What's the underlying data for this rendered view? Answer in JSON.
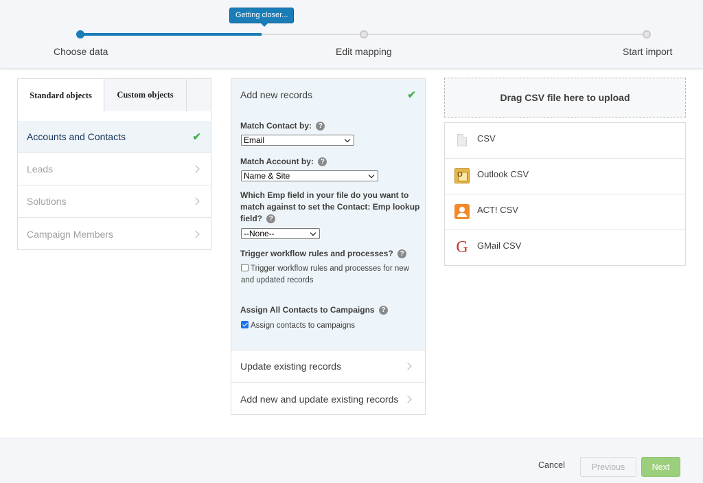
{
  "progress": {
    "tooltip": "Getting closer...",
    "fill_fraction": 0.32,
    "steps": [
      {
        "label": "Choose data",
        "state": "done"
      },
      {
        "label": "Edit mapping",
        "state": "todo"
      },
      {
        "label": "Start import",
        "state": "todo"
      }
    ]
  },
  "left_panel": {
    "tabs": [
      {
        "label": "Standard objects",
        "active": true
      },
      {
        "label": "Custom objects",
        "active": false
      }
    ],
    "items": [
      {
        "label": "Accounts and Contacts",
        "selected": true
      },
      {
        "label": "Leads",
        "selected": false
      },
      {
        "label": "Solutions",
        "selected": false
      },
      {
        "label": "Campaign Members",
        "selected": false
      }
    ]
  },
  "mid_panel": {
    "active_option": "Add new records",
    "match_contact": {
      "label": "Match Contact by:",
      "value": "Email"
    },
    "match_account": {
      "label": "Match Account by:",
      "value": "Name & Site"
    },
    "emp_field": {
      "label": "Which Emp field in your file do you want to match against to set the Contact: Emp lookup field?",
      "value": "--None--"
    },
    "trigger": {
      "label": "Trigger workflow rules and processes?",
      "checkbox_label": "Trigger workflow rules and processes for new and updated records",
      "checked": false
    },
    "campaigns": {
      "label": "Assign All Contacts to Campaigns",
      "checkbox_label": "Assign contacts to campaigns",
      "checked": true
    },
    "help_glyph": "?",
    "other_options": [
      {
        "label": "Update existing records"
      },
      {
        "label": "Add new and update existing records"
      }
    ]
  },
  "right_panel": {
    "drop_zone": "Drag CSV file here to upload",
    "sources": [
      {
        "label": "CSV",
        "icon": "document-icon"
      },
      {
        "label": "Outlook CSV",
        "icon": "outlook-icon"
      },
      {
        "label": "ACT! CSV",
        "icon": "act-icon"
      },
      {
        "label": "GMail CSV",
        "icon": "gmail-icon"
      }
    ]
  },
  "footer": {
    "cancel": "Cancel",
    "previous": "Previous",
    "next": "Next"
  },
  "colors": {
    "accent_blue": "#1b7db8",
    "success_green": "#4bae4f",
    "next_button": "#9ccf7c"
  }
}
